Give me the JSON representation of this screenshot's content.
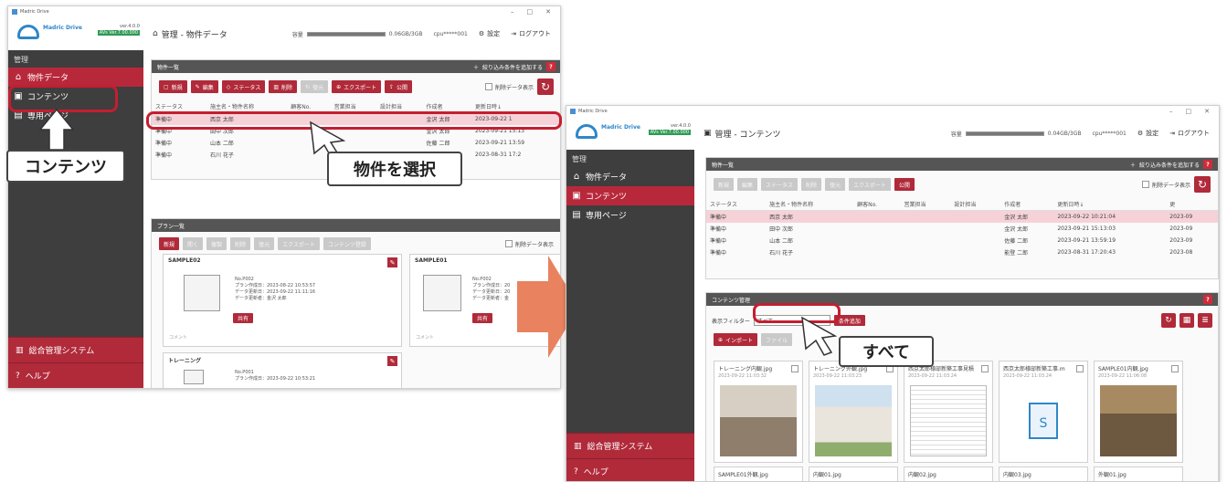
{
  "left_window": {
    "title": "Madric Drive",
    "brand": "Madric Drive",
    "version": "ver.4.0.0",
    "version_badge": "AVs Ver.7.00.000",
    "header_title": "管理 - 物件データ",
    "capacity_label": "容量",
    "capacity_text": "0.06GB/3GB",
    "cpu_text": "cpu*****001",
    "settings": "設定",
    "logout": "ログアウト",
    "side_heading": "管理",
    "side_items": [
      "物件データ",
      "コンテンツ",
      "専用ページ"
    ],
    "side_bottom": [
      "総合管理システム",
      "ヘルプ"
    ],
    "property_panel": {
      "title": "物件一覧",
      "add_filter": "絞り込み条件を追加する",
      "buttons": [
        "新規",
        "編集",
        "ステータス",
        "削除",
        "復元",
        "エクスポート",
        "公開"
      ],
      "show_deleted": "削除データ表示",
      "columns": [
        "ステータス",
        "施主名・物件名称",
        "顧客No.",
        "営業担当",
        "設計担当",
        "作成者",
        "更新日時↓"
      ],
      "rows": [
        [
          "準備中",
          "西京 太郎",
          "",
          "",
          "",
          "金沢 太郎",
          "2023-09-22 1"
        ],
        [
          "準備中",
          "田中 次郎",
          "",
          "",
          "",
          "金沢 太郎",
          "2023-09-21 15:13"
        ],
        [
          "準備中",
          "山本 二郎",
          "",
          "",
          "",
          "佐藤 二郎",
          "2023-09-21 13:59"
        ],
        [
          "準備中",
          "石川 花子",
          "",
          "",
          "",
          "能登 二郎",
          "2023-08-31 17:2"
        ]
      ]
    },
    "plan_panel": {
      "title": "プラン一覧",
      "buttons": [
        "新規",
        "開く",
        "複製",
        "削除",
        "復元",
        "エクスポート",
        "コンテンツ登録"
      ],
      "show_deleted": "削除データ表示",
      "cards": [
        {
          "name": "SAMPLE02",
          "no": "No.P002",
          "created": "プラン作成日：2023-08-22 10:53:57",
          "updated": "データ更新日：2023-09-22 11:11:16",
          "updater": "データ更新者：金沢 太郎",
          "comment": "コメント",
          "share": "共有"
        },
        {
          "name": "SAMPLE01",
          "no": "No.P002",
          "created": "プラン作成日：20",
          "updated": "データ更新日：20",
          "updater": "データ更新者：金",
          "comment": "コメント",
          "share": "共有"
        },
        {
          "name": "トレーニング",
          "no": "No.P001",
          "created": "プラン作成日：2023-09-22 10:53:21",
          "updated": "",
          "updater": "",
          "comment": "",
          "share": ""
        }
      ]
    }
  },
  "right_window": {
    "title": "Madric Drive",
    "brand": "Madric Drive",
    "version": "ver.4.0.0",
    "version_badge": "AVs Ver.7.00.000",
    "header_title": "管理 - コンテンツ",
    "capacity_label": "容量",
    "capacity_text": "0.04GB/3GB",
    "cpu_text": "cpu*****001",
    "settings": "設定",
    "logout": "ログアウト",
    "side_heading": "管理",
    "side_items": [
      "物件データ",
      "コンテンツ",
      "専用ページ"
    ],
    "side_bottom": [
      "総合管理システム",
      "ヘルプ"
    ],
    "property_panel": {
      "title": "物件一覧",
      "add_filter": "絞り込み条件を追加する",
      "buttons": [
        "新規",
        "編集",
        "ステータス",
        "削除",
        "復元",
        "エクスポート",
        "公開"
      ],
      "show_deleted": "削除データ表示",
      "columns": [
        "ステータス",
        "施主名・物件名称",
        "顧客No.",
        "営業担当",
        "設計担当",
        "作成者",
        "更新日時↓",
        "更"
      ],
      "rows": [
        [
          "準備中",
          "西京 太郎",
          "",
          "",
          "",
          "金沢 太郎",
          "2023-09-22 10:21:04",
          "2023-09"
        ],
        [
          "準備中",
          "田中 次郎",
          "",
          "",
          "",
          "金沢 太郎",
          "2023-09-21 15:13:03",
          "2023-09"
        ],
        [
          "準備中",
          "山本 二郎",
          "",
          "",
          "",
          "佐藤 二郎",
          "2023-09-21 13:59:19",
          "2023-09"
        ],
        [
          "準備中",
          "石川 花子",
          "",
          "",
          "",
          "能登 二郎",
          "2023-08-31 17:20:43",
          "2023-08"
        ]
      ]
    },
    "content_panel": {
      "title": "コンテンツ管理",
      "filter_label": "表示フィルター",
      "filter_value": "すべて",
      "add_condition": "条件追加",
      "import_button": "インポート",
      "file_button": "ファイル",
      "thumbs": [
        {
          "name": "トレーニング内観.jpg",
          "date": "2023-09-22 11:03:32"
        },
        {
          "name": "トレーニング外観.jpg",
          "date": "2023-09-22 11:03:23"
        },
        {
          "name": "西京太郎様邸新築工事見積",
          "date": "2023-09-22 11:03:24"
        },
        {
          "name": "西京太郎様邸新築工事.m",
          "date": "2023-09-22 11:03:24"
        },
        {
          "name": "SAMPLE01内観.jpg",
          "date": "2023-09-22 11:06:08"
        }
      ],
      "thumbs_row2": [
        "SAMPLE01外観.jpg",
        "内観01.jpg",
        "内観02.jpg",
        "内観03.jpg",
        "外観01.jpg"
      ]
    }
  },
  "callouts": {
    "contents": "コンテンツ",
    "select_property": "物件を選択",
    "all": "すべて"
  },
  "accent_color": "#b02a3a",
  "arrow_color": "#e8825f"
}
